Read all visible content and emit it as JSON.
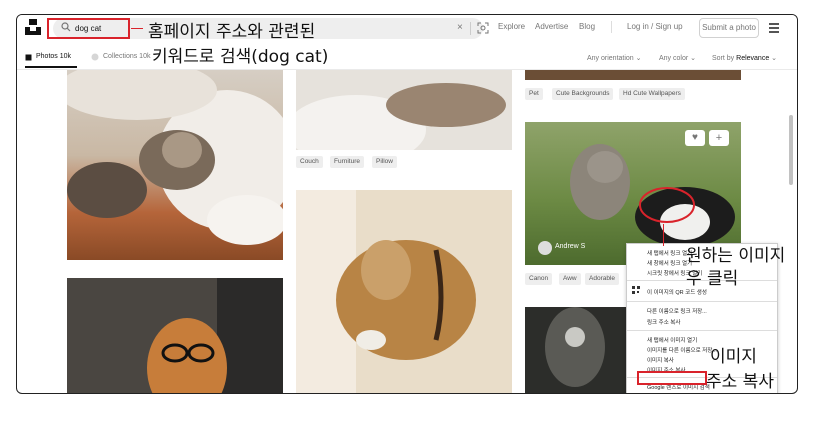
{
  "search": {
    "query": "dog cat",
    "clear_label": "×"
  },
  "nav": {
    "explore": "Explore",
    "advertise": "Advertise",
    "blog": "Blog",
    "login_signup": "Log in / Sign up",
    "submit": "Submit a photo"
  },
  "tabs": {
    "photos": "Photos 10k",
    "collections": "Collections 10k"
  },
  "filters": {
    "orientation": "Any orientation",
    "color": "Any color",
    "sort_prefix": "Sort by",
    "sort_value": "Relevance"
  },
  "tags": {
    "col2": [
      "Couch",
      "Furniture",
      "Pillow"
    ],
    "col3_top": [
      "Pet",
      "Cute Backgrounds",
      "Hd Cute Wallpapers"
    ],
    "col3_mid": [
      "Canon",
      "Aww",
      "Adorable"
    ]
  },
  "photo_credit": "Andrew S",
  "context_menu": {
    "items": [
      "새 탭에서 링크 열기",
      "새 창에서 링크 열기",
      "시크릿 창에서 링크 열기",
      "이 이미지의 QR 코드 생성",
      "다른 이름으로 링크 저장...",
      "링크 주소 복사",
      "새 탭에서 이미지 열기",
      "이미지를 다른 이름으로 저장...",
      "이미지 복사",
      "이미지 주소 복사",
      "Google 렌즈로 이미지 검색"
    ]
  },
  "annotations": {
    "search_note_1": "홈페이지 주소와 관련된",
    "search_note_2": "키워드로 검색(dog cat)",
    "right_click_1": "원하는 이미지",
    "right_click_2": "우 클릭",
    "copy_addr_1": "이미지",
    "copy_addr_2": "주소 복사"
  },
  "colors": {
    "annotation_red": "#d9232b",
    "text_dark": "#111111",
    "muted": "#767676"
  }
}
